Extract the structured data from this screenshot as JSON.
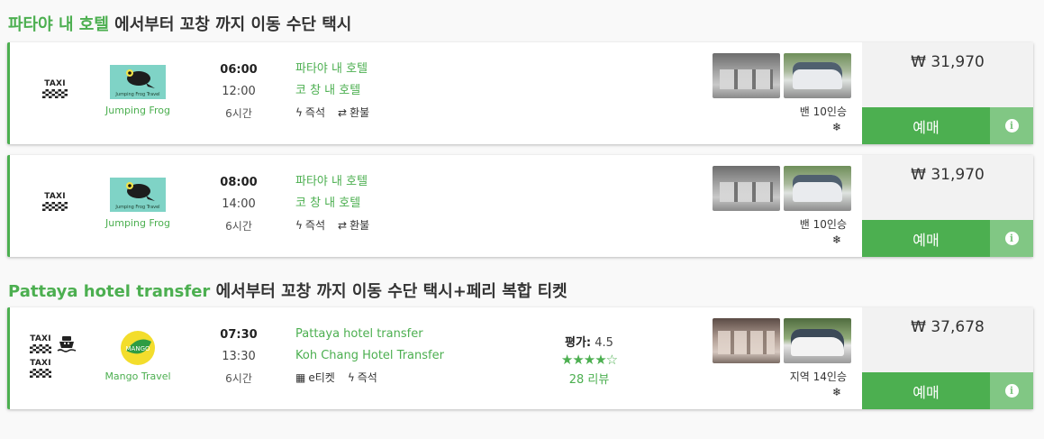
{
  "sections": [
    {
      "title_highlight": "파타야 내 호텔",
      "title_rest": " 에서부터 꼬창 까지 이동 수단 택시",
      "cards": [
        {
          "transport_label": "TAXI",
          "operator": "Jumping Frog",
          "logo_text": "Jumping Frog Travel",
          "departure": "06:00",
          "arrival": "12:00",
          "duration": "6시간",
          "from": "파타야 내 호텔",
          "to": "코 창 내 호텔",
          "features": [
            "즉석",
            "환불"
          ],
          "vehicle": "밴 10인승",
          "price": "₩ 31,970",
          "book_label": "예매"
        },
        {
          "transport_label": "TAXI",
          "operator": "Jumping Frog",
          "logo_text": "Jumping Frog Travel",
          "departure": "08:00",
          "arrival": "14:00",
          "duration": "6시간",
          "from": "파타야 내 호텔",
          "to": "코 창 내 호텔",
          "features": [
            "즉석",
            "환불"
          ],
          "vehicle": "밴 10인승",
          "price": "₩ 31,970",
          "book_label": "예매"
        }
      ]
    },
    {
      "title_highlight": "Pattaya hotel transfer",
      "title_rest": " 에서부터 꼬창 까지 이동 수단 택시+페리 복합 티켓",
      "cards": [
        {
          "transport_label": "TAXI",
          "operator": "Mango Travel",
          "logo_text": "MANGO",
          "departure": "07:30",
          "arrival": "13:30",
          "duration": "6시간",
          "from": "Pattaya hotel transfer",
          "to": "Koh Chang Hotel Transfer",
          "features": [
            "e티켓",
            "즉석"
          ],
          "rating_label": "평가:",
          "rating_value": "4.5",
          "stars": "★★★★☆",
          "reviews": "28 리뷰",
          "vehicle": "지역 14인승",
          "price": "₩ 37,678",
          "book_label": "예매"
        }
      ]
    }
  ],
  "icons": {
    "bolt": "bolt-icon",
    "refund": "exchange-icon",
    "qr": "qr-icon",
    "snow": "snowflake-icon",
    "info": "info-icon"
  },
  "colors": {
    "accent": "#4caf50",
    "accent_light": "#81c784"
  }
}
